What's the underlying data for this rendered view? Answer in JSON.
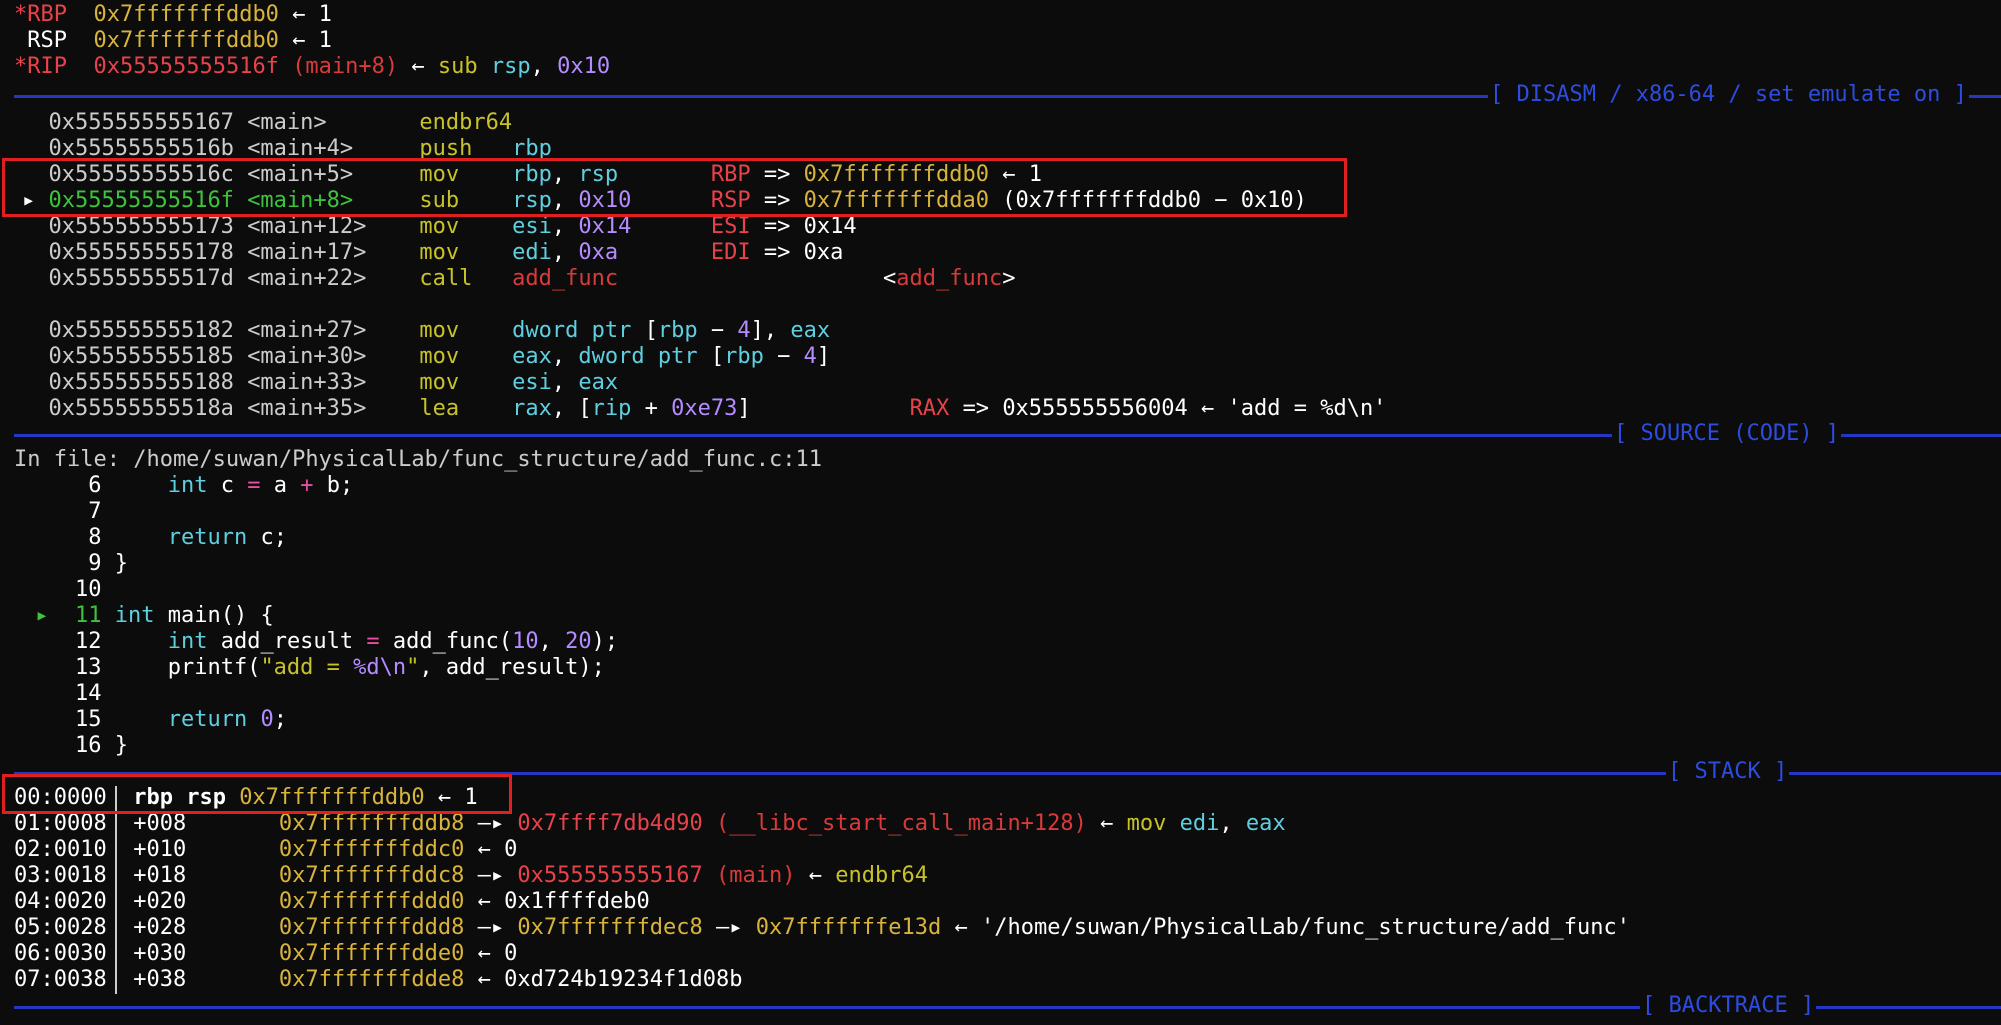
{
  "registers": [
    {
      "marker": "*",
      "name": "RBP",
      "value": "0x7fffffffddb0",
      "rest": "← 1",
      "modified": true
    },
    {
      "marker": " ",
      "name": "RSP",
      "value": "0x7fffffffddb0",
      "rest": "← 1",
      "modified": false
    },
    {
      "marker": "*",
      "name": "RIP",
      "value": "0x55555555516f",
      "sym": "(main+8)",
      "arrow": "←",
      "mnemonic": "sub",
      "op1": "rsp",
      "op2": "0x10",
      "modified": true
    }
  ],
  "sections": {
    "disasm": "[ DISASM / x86-64 / set emulate on ]",
    "source": "[ SOURCE (CODE) ]",
    "stack": "[ STACK ]",
    "backtrace": "[ BACKTRACE ]"
  },
  "disasm": [
    {
      "cur": "",
      "addr": "0x555555555167",
      "sym": "<main>",
      "mn": "endbr64",
      "ops": "",
      "comment": ""
    },
    {
      "cur": "",
      "addr": "0x55555555516b",
      "sym": "<main+4>",
      "mn": "push",
      "ops": "rbp",
      "comment": ""
    },
    {
      "cur": "",
      "addr": "0x55555555516c",
      "sym": "<main+5>",
      "mn": "mov",
      "ops": "rbp, rsp",
      "creg": "RBP",
      "carrow": "=>",
      "cval": "0x7fffffffddb0",
      "crest": "← 1"
    },
    {
      "cur": "▸",
      "addr": "0x55555555516f",
      "sym": "<main+8>",
      "mn": "sub",
      "ops": "rsp, 0x10",
      "creg": "RSP",
      "carrow": "=>",
      "cval": "0x7fffffffdda0",
      "crest": "(0x7fffffffddb0 − 0x10)"
    },
    {
      "cur": "",
      "addr": "0x555555555173",
      "sym": "<main+12>",
      "mn": "mov",
      "ops": "esi, 0x14",
      "creg": "ESI",
      "carrow": "=>",
      "cval": "0x14",
      "crest": ""
    },
    {
      "cur": "",
      "addr": "0x555555555178",
      "sym": "<main+17>",
      "mn": "mov",
      "ops": "edi, 0xa",
      "creg": "EDI",
      "carrow": "=>",
      "cval": "0xa",
      "crest": ""
    },
    {
      "cur": "",
      "addr": "0x55555555517d",
      "sym": "<main+22>",
      "mn": "call",
      "ops": "add_func",
      "ctarget": "<add_func>"
    },
    {
      "cur": "",
      "addr": "0x555555555182",
      "sym": "<main+27>",
      "mn": "mov",
      "ops": "dword ptr [rbp − 4], eax"
    },
    {
      "cur": "",
      "addr": "0x555555555185",
      "sym": "<main+30>",
      "mn": "mov",
      "ops": "eax, dword ptr [rbp − 4]"
    },
    {
      "cur": "",
      "addr": "0x555555555188",
      "sym": "<main+33>",
      "mn": "mov",
      "ops": "esi, eax"
    },
    {
      "cur": "",
      "addr": "0x55555555518a",
      "sym": "<main+35>",
      "mn": "lea",
      "ops": "rax, [rip + 0xe73]",
      "creg": "RAX",
      "carrow": "=>",
      "cval": "0x555555556004",
      "crest": "← 'add = %d\\n'"
    }
  ],
  "source": {
    "file_line": "In file: /home/suwan/PhysicalLab/func_structure/add_func.c:11",
    "lines": [
      {
        "n": "6",
        "code": "    int c = a + b;"
      },
      {
        "n": "7",
        "code": ""
      },
      {
        "n": "8",
        "code": "    return c;"
      },
      {
        "n": "9",
        "code": "}"
      },
      {
        "n": "10",
        "code": ""
      },
      {
        "n": "11",
        "code": "int main() {",
        "current": true,
        "marker": "▸"
      },
      {
        "n": "12",
        "code": "    int add_result = add_func(10, 20);"
      },
      {
        "n": "13",
        "code": "    printf(\"add = %d\\n\", add_result);"
      },
      {
        "n": "14",
        "code": ""
      },
      {
        "n": "15",
        "code": "    return 0;"
      },
      {
        "n": "16",
        "code": "}"
      }
    ]
  },
  "stack": [
    {
      "idx": "00:0000",
      "off": "",
      "regs": "rbp rsp",
      "addr": "0x7fffffffddb0",
      "rest": "← 1"
    },
    {
      "idx": "01:0008",
      "off": "+008",
      "addr": "0x7fffffffddb8",
      "arrow": "—▸",
      "target": "0x7ffff7db4d90",
      "target_sym": "(__libc_start_call_main+128)",
      "arrow2": "←",
      "mn": "mov",
      "ops": "edi, eax"
    },
    {
      "idx": "02:0010",
      "off": "+010",
      "addr": "0x7fffffffddc0",
      "rest": "← 0"
    },
    {
      "idx": "03:0018",
      "off": "+018",
      "addr": "0x7fffffffddc8",
      "arrow": "—▸",
      "target": "0x555555555167",
      "target_sym": "(main)",
      "arrow2": "←",
      "mn": "endbr64"
    },
    {
      "idx": "04:0020",
      "off": "+020",
      "addr": "0x7fffffffddd0",
      "rest": "← 0x1ffffdeb0"
    },
    {
      "idx": "05:0028",
      "off": "+028",
      "addr": "0x7fffffffddd8",
      "arrow": "—▸",
      "target2": "0x7fffffffdec8",
      "arrow_b": "—▸",
      "target3": "0x7fffffffe13d",
      "rest": "← '/home/suwan/PhysicalLab/func_structure/add_func'"
    },
    {
      "idx": "06:0030",
      "off": "+030",
      "addr": "0x7fffffffdde0",
      "rest": "← 0"
    },
    {
      "idx": "07:0038",
      "off": "+038",
      "addr": "0x7fffffffdde8",
      "rest": "← 0xd724b19234f1d08b"
    }
  ],
  "colors": {
    "separator": "#2437c4",
    "highlight_box": "#e02020",
    "background": "#0c0c0c"
  }
}
